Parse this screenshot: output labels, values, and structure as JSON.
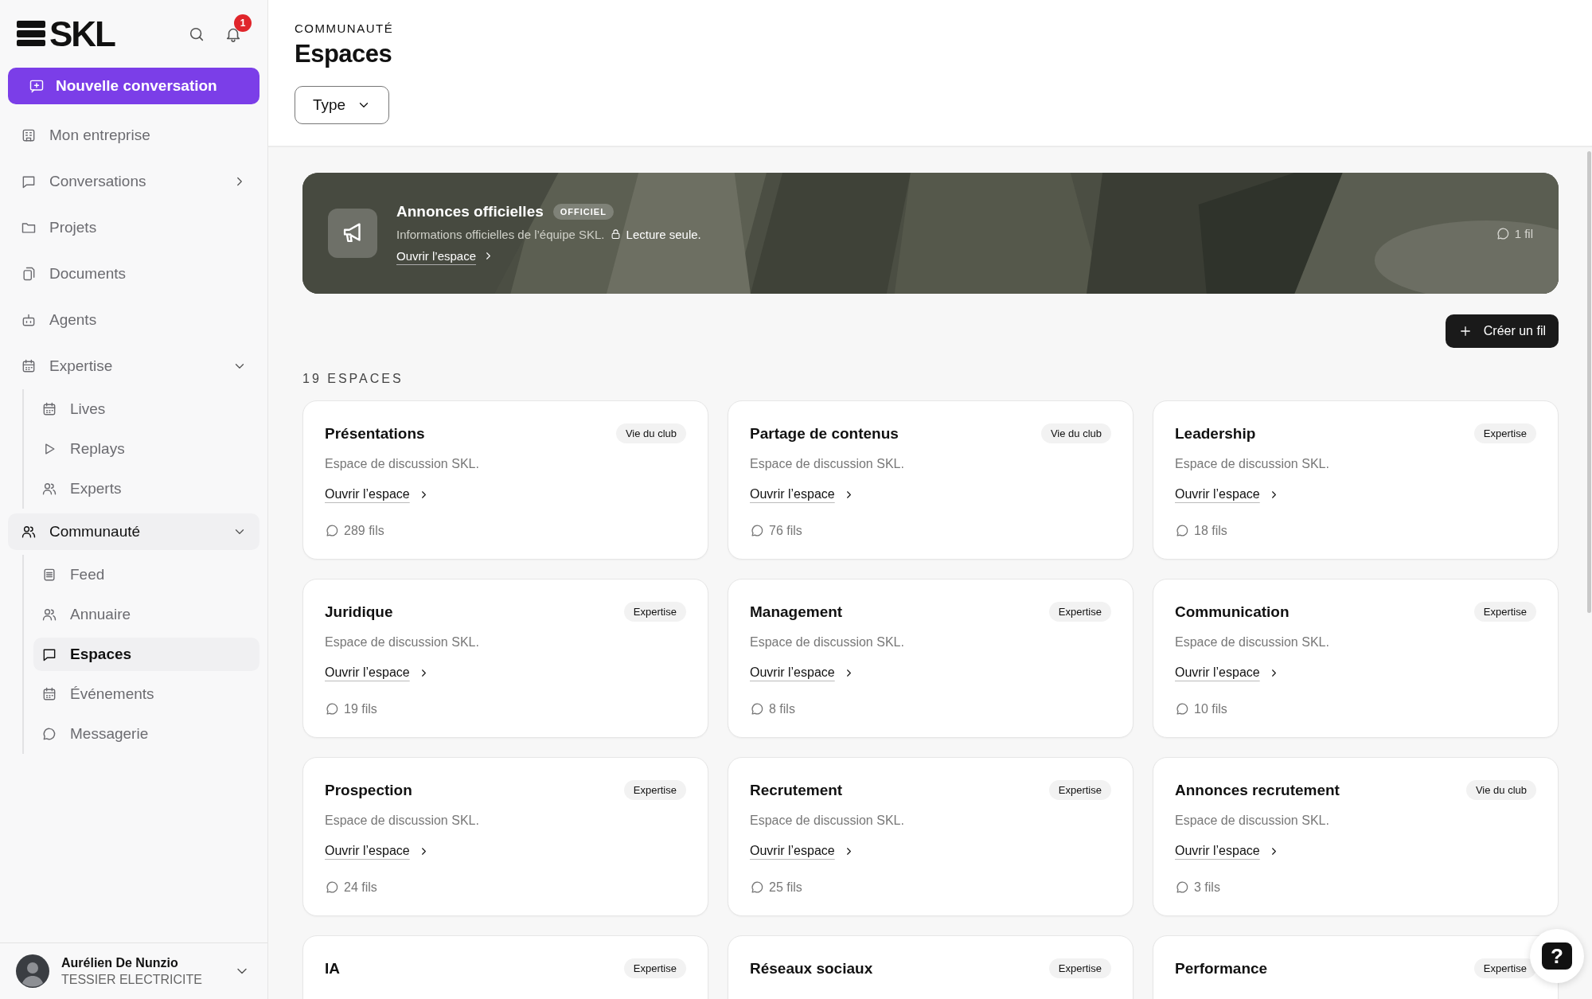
{
  "sidebar": {
    "logo": "SKL",
    "notification_count": "1",
    "new_conversation": "Nouvelle conversation",
    "items": [
      {
        "label": "Mon entreprise",
        "selected": false
      },
      {
        "label": "Conversations",
        "selected": false,
        "expanded": false
      },
      {
        "label": "Projets",
        "selected": false
      },
      {
        "label": "Documents",
        "selected": false
      },
      {
        "label": "Agents",
        "selected": false
      },
      {
        "label": "Expertise",
        "selected": false,
        "expanded": true,
        "children": [
          {
            "label": "Lives",
            "selected": false
          },
          {
            "label": "Replays",
            "selected": false
          },
          {
            "label": "Experts",
            "selected": false
          }
        ]
      },
      {
        "label": "Communauté",
        "selected": true,
        "expanded": true,
        "children": [
          {
            "label": "Feed",
            "selected": false
          },
          {
            "label": "Annuaire",
            "selected": false
          },
          {
            "label": "Espaces",
            "selected": true
          },
          {
            "label": "Événements",
            "selected": false
          },
          {
            "label": "Messagerie",
            "selected": false
          }
        ]
      }
    ],
    "user": {
      "name": "Aurélien De Nunzio",
      "company": "TESSIER ELECTRICITE"
    }
  },
  "header": {
    "breadcrumb": "COMMUNAUTÉ",
    "title": "Espaces",
    "filter": "Type"
  },
  "banner": {
    "title": "Annonces officielles",
    "badge": "OFFICIEL",
    "description": "Informations officielles de l’équipe SKL.",
    "readonly": "Lecture seule.",
    "link": "Ouvrir l’espace",
    "count": "1 fil"
  },
  "create_button": "Créer un fil",
  "count_heading": "19 ESPACES",
  "spaces": [
    {
      "title": "Présentations",
      "tag": "Vie du club",
      "description": "Espace de discussion SKL.",
      "link": "Ouvrir l’espace",
      "count": "289 fils"
    },
    {
      "title": "Partage de contenus",
      "tag": "Vie du club",
      "description": "Espace de discussion SKL.",
      "link": "Ouvrir l’espace",
      "count": "76 fils"
    },
    {
      "title": "Leadership",
      "tag": "Expertise",
      "description": "Espace de discussion SKL.",
      "link": "Ouvrir l’espace",
      "count": "18 fils"
    },
    {
      "title": "Juridique",
      "tag": "Expertise",
      "description": "Espace de discussion SKL.",
      "link": "Ouvrir l’espace",
      "count": "19 fils"
    },
    {
      "title": "Management",
      "tag": "Expertise",
      "description": "Espace de discussion SKL.",
      "link": "Ouvrir l’espace",
      "count": "8 fils"
    },
    {
      "title": "Communication",
      "tag": "Expertise",
      "description": "Espace de discussion SKL.",
      "link": "Ouvrir l’espace",
      "count": "10 fils"
    },
    {
      "title": "Prospection",
      "tag": "Expertise",
      "description": "Espace de discussion SKL.",
      "link": "Ouvrir l’espace",
      "count": "24 fils"
    },
    {
      "title": "Recrutement",
      "tag": "Expertise",
      "description": "Espace de discussion SKL.",
      "link": "Ouvrir l’espace",
      "count": "25 fils"
    },
    {
      "title": "Annonces recrutement",
      "tag": "Vie du club",
      "description": "Espace de discussion SKL.",
      "link": "Ouvrir l’espace",
      "count": "3 fils"
    },
    {
      "title": "IA",
      "tag": "Expertise"
    },
    {
      "title": "Réseaux sociaux",
      "tag": "Expertise"
    },
    {
      "title": "Performance",
      "tag": "Expertise"
    }
  ],
  "help_button": "?"
}
